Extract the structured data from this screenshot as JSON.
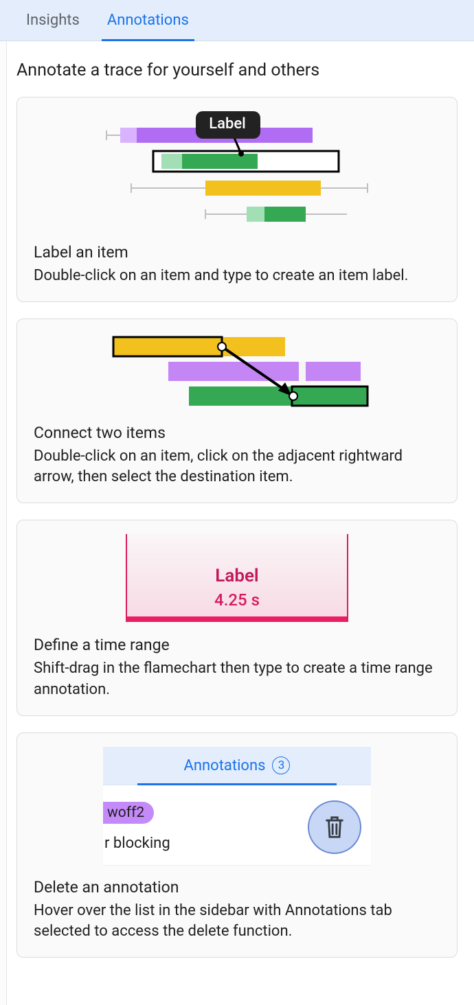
{
  "tabs": {
    "insights": "Insights",
    "annotations": "Annotations"
  },
  "page_title": "Annotate a trace for yourself and others",
  "card1": {
    "badge": "Label",
    "title": "Label an item",
    "desc": "Double-click on an item and type to create an item label."
  },
  "card2": {
    "title": "Connect two items",
    "desc": "Double-click on an item, click on the adjacent rightward arrow, then select the destination item."
  },
  "card3": {
    "range_label": "Label",
    "range_time": "4.25 s",
    "title": "Define a time range",
    "desc": "Shift-drag in the flamechart then type to create a time range annotation."
  },
  "card4": {
    "tab_label": "Annotations",
    "count": "3",
    "pill": "woff2",
    "line2": "r blocking",
    "title": "Delete an annotation",
    "desc": "Hover over the list in the sidebar with Annotations tab selected to access the delete function."
  }
}
